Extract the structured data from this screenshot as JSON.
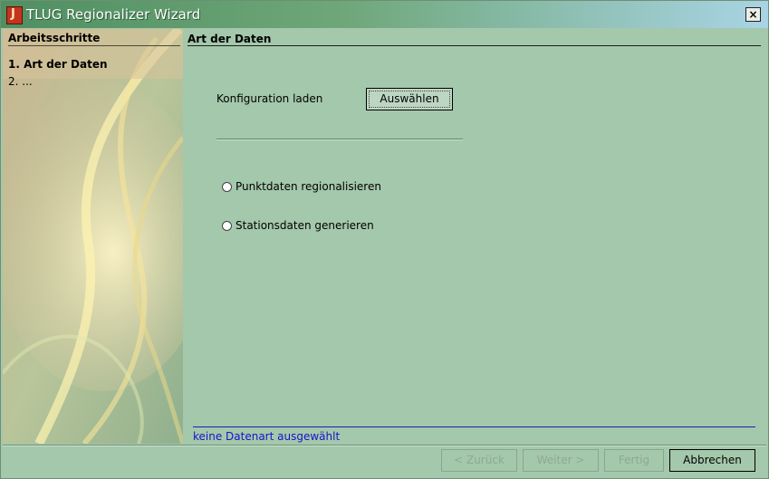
{
  "window": {
    "title": "TLUG Regionalizer Wizard",
    "icon": "java-icon",
    "close_glyph": "×"
  },
  "sidebar": {
    "title": "Arbeitsschritte",
    "steps": [
      {
        "label": "1. Art der Daten",
        "active": true
      },
      {
        "label": "2. ...",
        "active": false
      }
    ]
  },
  "panel": {
    "title": "Art der Daten",
    "config_label": "Konfiguration laden",
    "select_button": "Auswählen",
    "options": [
      {
        "label": "Punktdaten regionalisieren",
        "selected": false
      },
      {
        "label": "Stationsdaten generieren",
        "selected": false
      }
    ]
  },
  "status": {
    "text": "keine Datenart ausgewählt"
  },
  "buttons": {
    "back": "< Zurück",
    "next": "Weiter >",
    "finish": "Fertig",
    "cancel": "Abbrechen"
  },
  "colors": {
    "background": "#a4c8ab",
    "status_text": "#1515c8",
    "sidebar": "#d7c29b"
  }
}
